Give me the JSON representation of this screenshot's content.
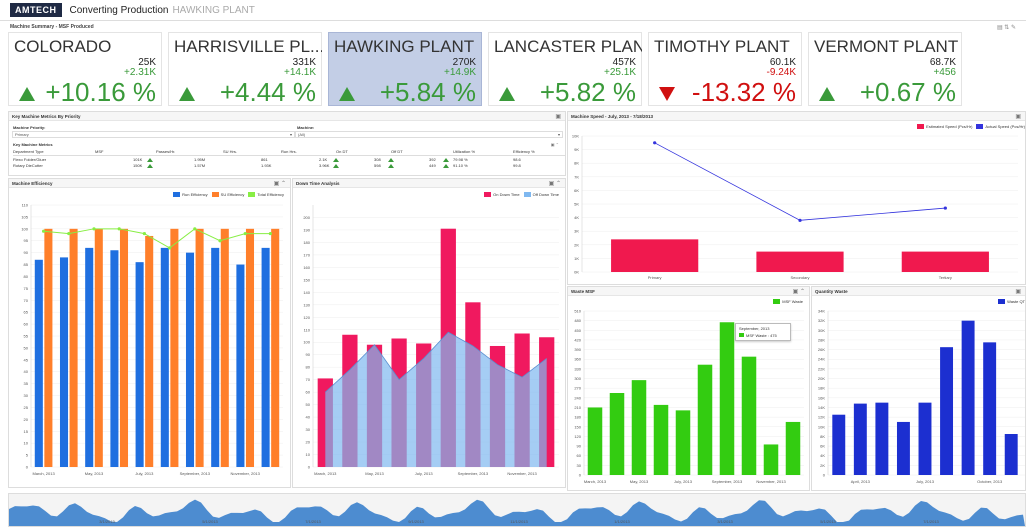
{
  "app": {
    "logo": "AMTECH",
    "title": "Converting Production",
    "subtitle": "HAWKING PLANT"
  },
  "summary": {
    "header": "Machine Summary - MSF Produced",
    "tiles": [
      {
        "name": "COLORADO",
        "value": "25K",
        "delta": "+2.31K",
        "pct": "+10.16 %",
        "trend": "up",
        "selected": false
      },
      {
        "name": "HARRISVILLE PL...",
        "value": "331K",
        "delta": "+14.1K",
        "pct": "+4.44 %",
        "trend": "up",
        "selected": false
      },
      {
        "name": "HAWKING PLANT",
        "value": "270K",
        "delta": "+14.9K",
        "pct": "+5.84 %",
        "trend": "up",
        "selected": true
      },
      {
        "name": "LANCASTER PLANT",
        "value": "457K",
        "delta": "+25.1K",
        "pct": "+5.82 %",
        "trend": "up",
        "selected": false
      },
      {
        "name": "TIMOTHY PLANT",
        "value": "60.1K",
        "delta": "-9.24K",
        "pct": "-13.32 %",
        "trend": "down",
        "selected": false
      },
      {
        "name": "VERMONT PLANT",
        "value": "68.7K",
        "delta": "+456",
        "pct": "+0.67 %",
        "trend": "up",
        "selected": false
      }
    ]
  },
  "key_metrics": {
    "header": "Key Machine Metrics By Priority",
    "priority_label": "Machine Priority:",
    "priority_value": "Primary",
    "machine_label": "Machine:",
    "machine_value": "(All)",
    "table_title": "Key Machine Metrics",
    "columns": [
      "Department Type",
      "MSF",
      "Passes/Hr.",
      "SU Hrs.",
      "Run Hrs.",
      "On DT",
      "Off DT",
      "Utilization %",
      "Efficiency %"
    ],
    "rows": [
      [
        "Flexo Folder/Gluer",
        "101K",
        "1.95M",
        "861",
        "2.1K",
        "308",
        "392",
        "79.98 %",
        "98.6"
      ],
      [
        "Rotary DieCutter",
        "150K",
        "1.57M",
        "1.93K",
        "3.96K",
        "598",
        "449",
        "91.10 %",
        "99.8"
      ]
    ]
  },
  "machine_efficiency": {
    "header": "Machine Efficiency",
    "legend": [
      "Run Efficiency",
      "SU Efficiency",
      "Total Efficiency"
    ],
    "colors": {
      "run": "#1f6fe0",
      "su": "#ff7f2a",
      "total": "#88ee44"
    }
  },
  "down_time": {
    "header": "Down Time Analysis",
    "legend": [
      "On Down Time",
      "Off Down Time"
    ],
    "colors": {
      "on": "#f0195f",
      "off": "#7fb8f0"
    }
  },
  "machine_speed": {
    "header": "Machine Speed - July, 2013 - 7/18/2013",
    "legend": [
      "Estimated Speed (Pcs/Hr)",
      "Actual Speed (Pcs/Hr)"
    ],
    "colors": {
      "est": "#f0194e",
      "act": "#3333dd"
    }
  },
  "waste_msf": {
    "header": "Waste MSF",
    "legend": "MSF Waste",
    "tooltip_title": "September, 2013",
    "tooltip_value": "MSF Waste : 475",
    "color": "#33cc11"
  },
  "quantity_waste": {
    "header": "Quantity Waste",
    "legend": "Waste QT",
    "color": "#1c2fd0"
  },
  "timeline": {
    "labels": [
      "3/1/2013",
      "5/1/2013",
      "7/1/2013",
      "9/1/2013",
      "11/1/2013",
      "1/1/2013",
      "3/1/2013",
      "5/1/2013",
      "7/1/2013",
      "9/1/2013"
    ]
  },
  "chart_data": [
    {
      "type": "bar",
      "title": "Machine Efficiency",
      "categories": [
        "March, 2013",
        "April, 2013",
        "May, 2013",
        "June, 2013",
        "July, 2013",
        "August, 2013",
        "September, 2013",
        "October, 2013",
        "November, 2013",
        "December, 2013"
      ],
      "x_tick_labels": [
        "March, 2013",
        "May, 2013",
        "July, 2013",
        "September, 2013",
        "November, 2013"
      ],
      "ylim": [
        0,
        110
      ],
      "y_ticks": [
        0,
        5,
        10,
        15,
        20,
        25,
        30,
        35,
        40,
        45,
        50,
        55,
        60,
        65,
        70,
        75,
        80,
        85,
        90,
        95,
        100,
        105,
        110
      ],
      "series": [
        {
          "name": "Run Efficiency",
          "values": [
            87,
            88,
            92,
            91,
            86,
            92,
            90,
            92,
            85,
            92
          ]
        },
        {
          "name": "SU Efficiency",
          "values": [
            100,
            100,
            100,
            100,
            97,
            100,
            100,
            100,
            100,
            100
          ]
        },
        {
          "name": "Total Efficiency",
          "values": [
            99,
            98,
            100,
            100,
            98,
            92,
            100,
            95,
            98,
            98
          ],
          "type": "line"
        }
      ]
    },
    {
      "type": "bar",
      "title": "Down Time Analysis",
      "categories": [
        "March, 2013",
        "April, 2013",
        "May, 2013",
        "June, 2013",
        "July, 2013",
        "August, 2013",
        "September, 2013",
        "October, 2013",
        "November, 2013",
        "December, 2013"
      ],
      "x_tick_labels": [
        "March, 2013",
        "May, 2013",
        "July, 2013",
        "September, 2013",
        "November, 2013"
      ],
      "ylim": [
        0,
        210
      ],
      "y_ticks": [
        0,
        10,
        20,
        30,
        40,
        50,
        60,
        70,
        80,
        90,
        100,
        110,
        120,
        130,
        140,
        150,
        160,
        170,
        180,
        190,
        200
      ],
      "series": [
        {
          "name": "On Down Time",
          "values": [
            71,
            106,
            98,
            103,
            99,
            191,
            132,
            97,
            107,
            104
          ]
        },
        {
          "name": "Off Down Time",
          "values": [
            60,
            78,
            98,
            70,
            87,
            108,
            97,
            82,
            72,
            87
          ],
          "type": "area"
        }
      ]
    },
    {
      "type": "bar",
      "title": "Machine Speed - July, 2013 - 7/18/2013",
      "categories": [
        "Primary",
        "Secondary",
        "Tertiary"
      ],
      "ylim": [
        0,
        10000
      ],
      "y_ticks": [
        "0K",
        "1K",
        "2K",
        "3K",
        "4K",
        "5K",
        "6K",
        "7K",
        "8K",
        "9K",
        "10K"
      ],
      "series": [
        {
          "name": "Estimated Speed (Pcs/Hr)",
          "values": [
            2400,
            1500,
            1500
          ]
        },
        {
          "name": "Actual Speed (Pcs/Hr)",
          "values": [
            9500,
            3800,
            4700
          ],
          "type": "line"
        }
      ]
    },
    {
      "type": "bar",
      "title": "Waste MSF",
      "categories": [
        "March, 2013",
        "April, 2013",
        "May, 2013",
        "June, 2013",
        "July, 2013",
        "August, 2013",
        "September, 2013",
        "October, 2013",
        "November, 2013",
        "December, 2013"
      ],
      "x_tick_labels": [
        "March, 2013",
        "May, 2013",
        "July, 2013",
        "September, 2013",
        "November, 2013"
      ],
      "ylim": [
        0,
        510
      ],
      "y_ticks": [
        0,
        30,
        60,
        90,
        120,
        150,
        180,
        210,
        240,
        270,
        300,
        330,
        360,
        390,
        420,
        450,
        480,
        510
      ],
      "series": [
        {
          "name": "MSF Waste",
          "values": [
            210,
            255,
            295,
            218,
            201,
            343,
            475,
            368,
            95,
            165
          ]
        }
      ]
    },
    {
      "type": "bar",
      "title": "Quantity Waste",
      "categories": [
        "March, 2013",
        "April, 2013",
        "May, 2013",
        "June, 2013",
        "July, 2013",
        "August, 2013",
        "September, 2013",
        "October, 2013",
        "November, 2013"
      ],
      "x_tick_labels": [
        "April, 2013",
        "July, 2013",
        "October, 2013"
      ],
      "ylim": [
        0,
        34000
      ],
      "y_ticks": [
        "0",
        "2K",
        "4K",
        "6K",
        "8K",
        "10K",
        "12K",
        "14K",
        "16K",
        "18K",
        "20K",
        "22K",
        "24K",
        "26K",
        "28K",
        "30K",
        "32K",
        "34K"
      ],
      "series": [
        {
          "name": "Waste QT",
          "values": [
            12500,
            14800,
            15000,
            11000,
            15000,
            26500,
            32000,
            27500,
            8500,
            10600
          ]
        }
      ]
    }
  ]
}
